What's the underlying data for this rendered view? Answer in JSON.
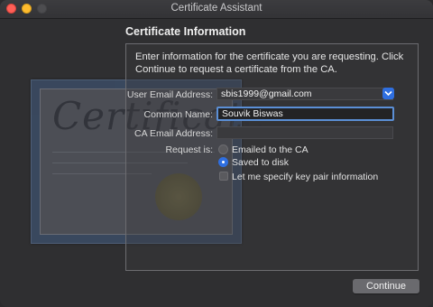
{
  "window": {
    "title": "Certificate Assistant"
  },
  "section": {
    "title": "Certificate Information",
    "intro": "Enter information for the certificate you are requesting. Click Continue to request a certificate from the CA."
  },
  "form": {
    "user_email_label": "User Email Address:",
    "user_email_value": "sbis1999@gmail.com",
    "common_name_label": "Common Name:",
    "common_name_value": "Souvik Biswas",
    "ca_email_label": "CA Email Address:",
    "ca_email_value": "",
    "request_is_label": "Request is:",
    "options": [
      {
        "label": "Emailed to the CA",
        "selected": false
      },
      {
        "label": "Saved to disk",
        "selected": true
      }
    ],
    "keypair_label": "Let me specify key pair information",
    "keypair_checked": false
  },
  "footer": {
    "continue_label": "Continue"
  },
  "colors": {
    "accent": "#2f6fe0",
    "focus_ring": "#5b8fd6",
    "close": "#ff5f57",
    "minimize": "#febc2e"
  }
}
